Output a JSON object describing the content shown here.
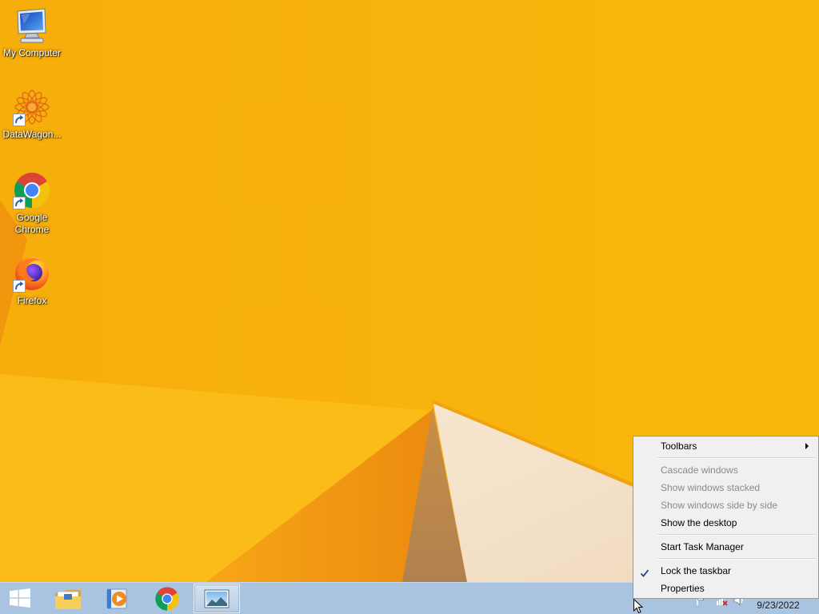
{
  "desktop": {
    "icons": [
      {
        "label": "My Computer",
        "icon": "my-computer-icon",
        "shortcut": false
      },
      {
        "label": "DataWagon...",
        "icon": "datawagon-icon",
        "shortcut": true
      },
      {
        "label": "Google Chrome",
        "icon": "chrome-icon",
        "shortcut": true
      },
      {
        "label": "Firefox",
        "icon": "firefox-icon",
        "shortcut": true
      }
    ]
  },
  "taskbar": {
    "start_button": {
      "icon": "windows-logo-icon"
    },
    "buttons": [
      {
        "icon": "file-explorer-icon",
        "active": false
      },
      {
        "icon": "media-player-icon",
        "active": false
      },
      {
        "icon": "chrome-icon",
        "active": false
      },
      {
        "icon": "picture-viewer-icon",
        "active": true
      }
    ],
    "tray": {
      "icons": [
        "action-center-flag-icon",
        "network-disconnected-icon",
        "volume-icon"
      ],
      "date": "9/23/2022"
    }
  },
  "context_menu": {
    "groups": [
      [
        {
          "label": "Toolbars",
          "enabled": true,
          "submenu": true
        }
      ],
      [
        {
          "label": "Cascade windows",
          "enabled": false
        },
        {
          "label": "Show windows stacked",
          "enabled": false
        },
        {
          "label": "Show windows side by side",
          "enabled": false
        },
        {
          "label": "Show the desktop",
          "enabled": true
        }
      ],
      [
        {
          "label": "Start Task Manager",
          "enabled": true
        }
      ],
      [
        {
          "label": "Lock the taskbar",
          "enabled": true,
          "checked": true
        },
        {
          "label": "Properties",
          "enabled": true
        }
      ]
    ]
  },
  "colors": {
    "wallpaper": "#F8B30A",
    "taskbar": "#A9C4E0",
    "menu_background": "#F0F0F0",
    "menu_disabled_text": "#8A8A8A"
  }
}
